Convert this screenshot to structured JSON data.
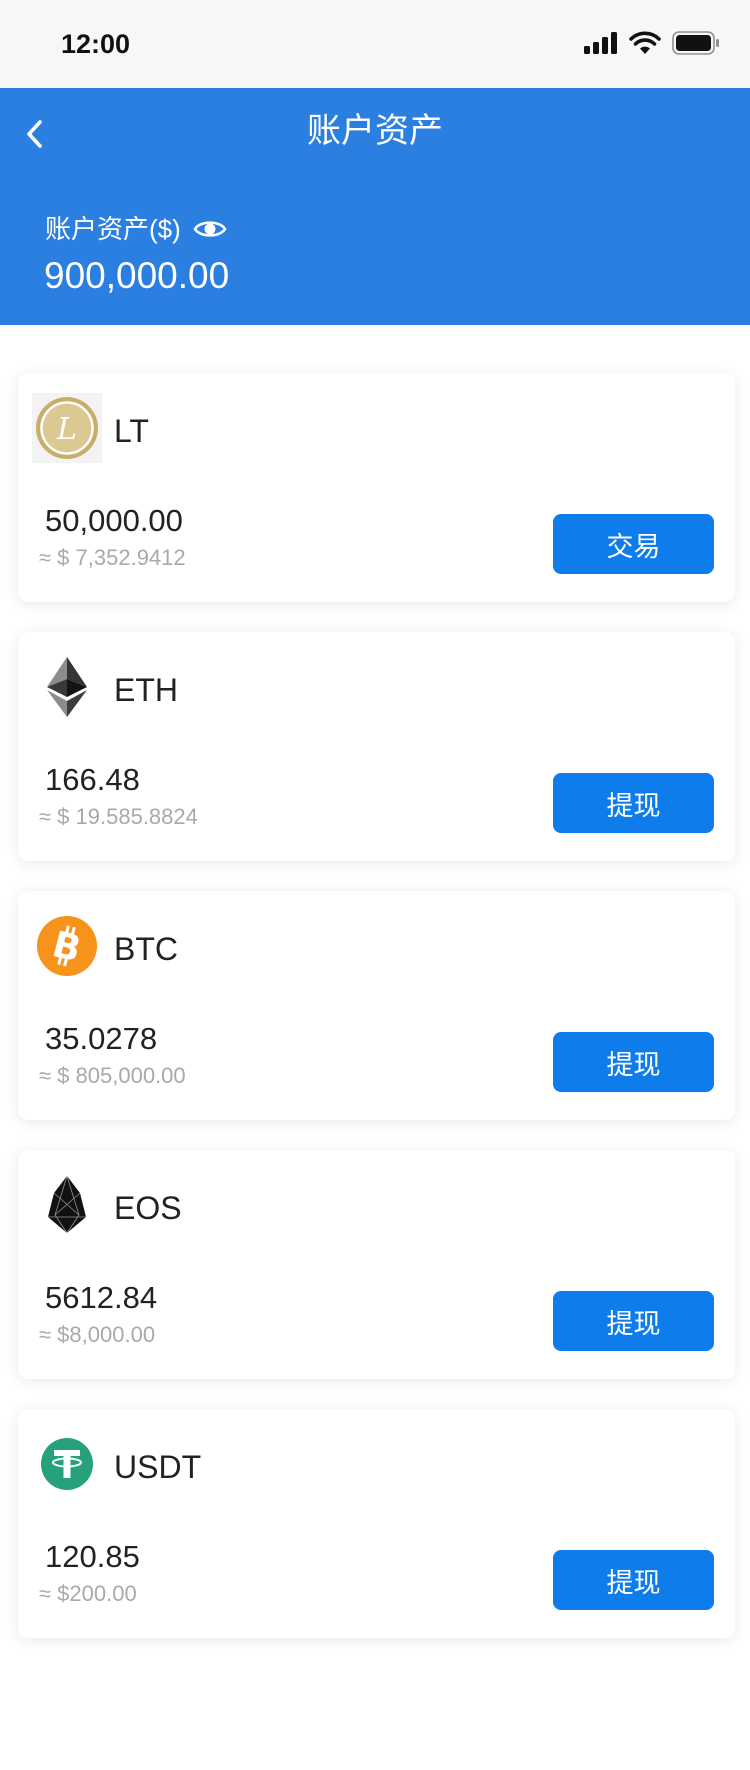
{
  "status_bar": {
    "time": "12:00",
    "icons": [
      "signal-icon",
      "wifi-icon",
      "battery-icon"
    ]
  },
  "header": {
    "title": "账户资产",
    "back_icon": "chevron-left-icon"
  },
  "summary": {
    "label": "账户资产($)",
    "total": "900,000.00",
    "eye_icon": "eye-icon"
  },
  "colors": {
    "header_bg": "#2B7FE0",
    "button_bg": "#0E7CEA",
    "text_dark": "#222222",
    "text_gray": "#A9A9A9",
    "lt_gold": "#C9AE6A",
    "btc_orange": "#F7931A",
    "usdt_green": "#26A17B"
  },
  "assets": [
    {
      "symbol": "LT",
      "amount": "50,000.00",
      "approx": "≈ $ 7,352.9412",
      "action": "交易",
      "icon": "lt-coin-icon",
      "icon_glyph": "L"
    },
    {
      "symbol": "ETH",
      "amount": "166.48",
      "approx": "≈ $ 19.585.8824",
      "action": "提现",
      "icon": "eth-icon"
    },
    {
      "symbol": "BTC",
      "amount": "35.0278",
      "approx": "≈ $ 805,000.00",
      "action": "提现",
      "icon": "btc-icon",
      "icon_glyph": "B"
    },
    {
      "symbol": "EOS",
      "amount": "5612.84",
      "approx": "≈ $8,000.00",
      "action": "提现",
      "icon": "eos-icon"
    },
    {
      "symbol": "USDT",
      "amount": "120.85",
      "approx": "≈ $200.00",
      "action": "提现",
      "icon": "usdt-icon"
    }
  ]
}
